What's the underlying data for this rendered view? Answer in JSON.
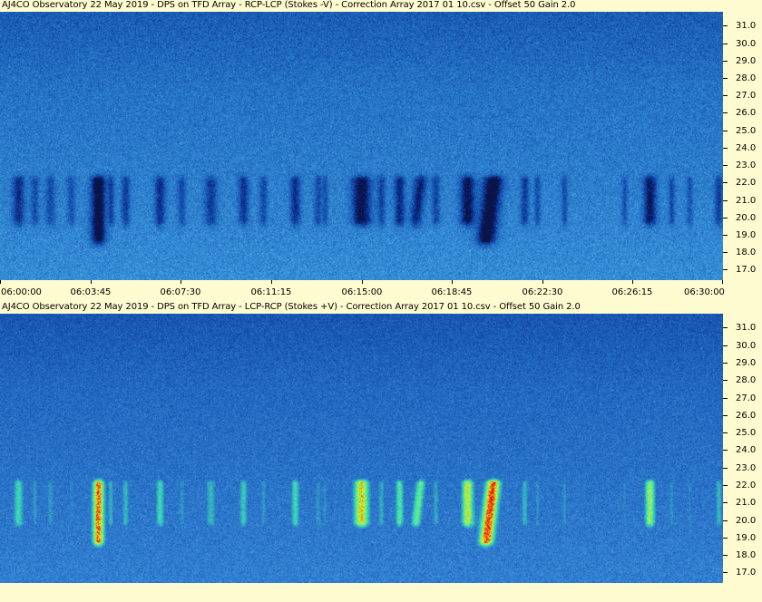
{
  "window": {
    "top_title": "AJ4CO Observatory 22 May 2019  -  DPS on TFD Array  -  RCP-LCP (Stokes -V)  -  Correction Array 2017 01 10.csv  -  Offset 50  Gain 2.0",
    "bottom_title": "AJ4CO Observatory 22 May 2019  -  DPS on TFD Array  -  LCP-RCP (Stokes +V)  -  Correction Array 2017 01 10.csv  -  Offset 50  Gain 2.0"
  },
  "frequency_axis": {
    "labels": [
      "31.0",
      "30.0",
      "29.0",
      "28.0",
      "27.0",
      "26.0",
      "25.0",
      "24.0",
      "23.0",
      "22.0",
      "21.0",
      "20.0",
      "19.0",
      "18.0",
      "17.0"
    ],
    "range": [
      16.4,
      31.8
    ]
  },
  "time_axis": {
    "labels": [
      "06:00:00",
      "06:03:45",
      "06:07:30",
      "06:11:15",
      "06:15:00",
      "06:18:45",
      "06:22:30",
      "06:26:15",
      "06:30:00"
    ]
  },
  "panels": [
    {
      "id": "top",
      "polarization": "RCP-LCP (Stokes -V)",
      "colormap": "blue-dark-bursts"
    },
    {
      "id": "bottom",
      "polarization": "LCP-RCP (Stokes +V)",
      "colormap": "blue-jet-bursts"
    }
  ],
  "colors": {
    "background": "#fffbd0",
    "spectrogram_base": "#1e5fd8",
    "burst_dark": "#000a3a",
    "burst_bright": "#d0f020",
    "burst_peak": "#ff2000"
  }
}
